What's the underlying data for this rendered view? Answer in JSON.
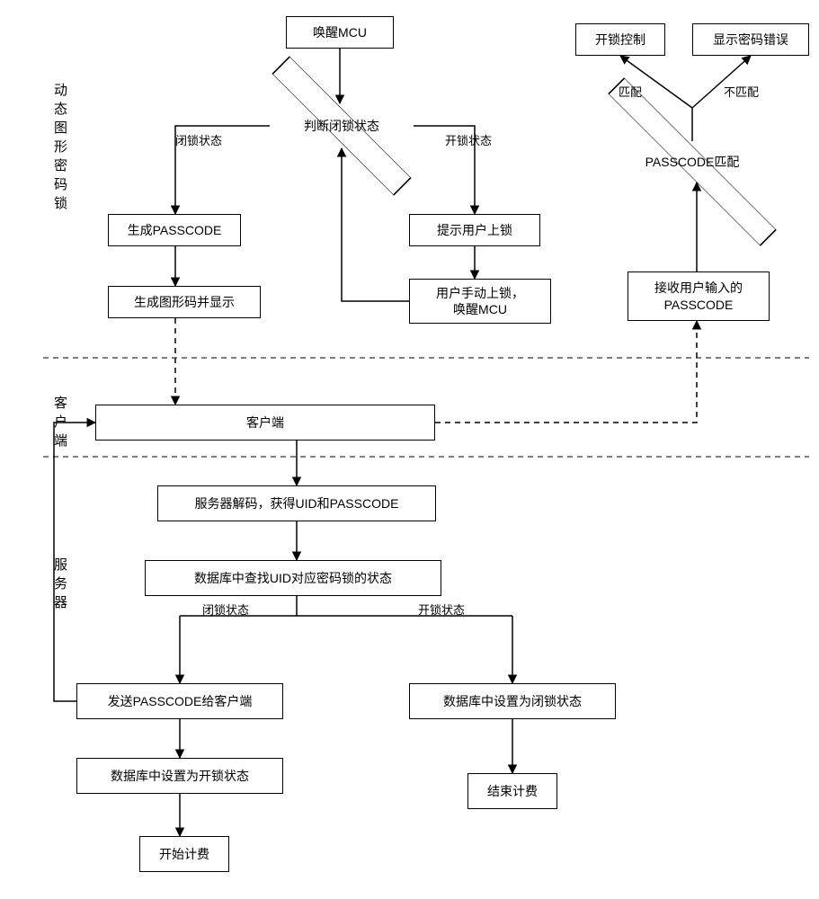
{
  "swimlanes": {
    "lane1": "动态图形密码锁",
    "lane2": "客户端",
    "lane3": "服务器"
  },
  "nodes": {
    "wake_mcu": "唤醒MCU",
    "judge_lock": "判断闭锁状态",
    "gen_passcode": "生成PASSCODE",
    "gen_qr": "生成图形码并显示",
    "prompt_lock": "提示用户上锁",
    "manual_lock": "用户手动上锁，\n唤醒MCU",
    "client": "客户端",
    "server_decode": "服务器解码，获得UID和PASSCODE",
    "db_lookup": "数据库中查找UID对应密码锁的状态",
    "send_passcode": "发送PASSCODE给客户端",
    "set_unlock": "数据库中设置为开锁状态",
    "start_billing": "开始计费",
    "set_lock": "数据库中设置为闭锁状态",
    "end_billing": "结束计费",
    "recv_passcode": "接收用户输入的\nPASSCODE",
    "passcode_match": "PASSCODE匹配",
    "unlock_ctrl": "开锁控制",
    "show_error": "显示密码错误"
  },
  "edge_labels": {
    "locked": "闭锁状态",
    "unlocked": "开锁状态",
    "locked2": "闭锁状态",
    "unlocked2": "开锁状态",
    "match": "匹配",
    "nomatch": "不匹配"
  },
  "chart_data": {
    "type": "flowchart",
    "swimlanes": [
      "动态图形密码锁",
      "客户端",
      "服务器"
    ],
    "nodes": [
      {
        "id": "wake_mcu",
        "label": "唤醒MCU",
        "lane": "动态图形密码锁",
        "shape": "rect"
      },
      {
        "id": "judge_lock",
        "label": "判断闭锁状态",
        "lane": "动态图形密码锁",
        "shape": "diamond"
      },
      {
        "id": "gen_passcode",
        "label": "生成PASSCODE",
        "lane": "动态图形密码锁",
        "shape": "rect"
      },
      {
        "id": "gen_qr",
        "label": "生成图形码并显示",
        "lane": "动态图形密码锁",
        "shape": "rect"
      },
      {
        "id": "prompt_lock",
        "label": "提示用户上锁",
        "lane": "动态图形密码锁",
        "shape": "rect"
      },
      {
        "id": "manual_lock",
        "label": "用户手动上锁，唤醒MCU",
        "lane": "动态图形密码锁",
        "shape": "rect"
      },
      {
        "id": "recv_passcode",
        "label": "接收用户输入的PASSCODE",
        "lane": "动态图形密码锁",
        "shape": "rect"
      },
      {
        "id": "passcode_match",
        "label": "PASSCODE匹配",
        "lane": "动态图形密码锁",
        "shape": "diamond"
      },
      {
        "id": "unlock_ctrl",
        "label": "开锁控制",
        "lane": "动态图形密码锁",
        "shape": "rect"
      },
      {
        "id": "show_error",
        "label": "显示密码错误",
        "lane": "动态图形密码锁",
        "shape": "rect"
      },
      {
        "id": "client",
        "label": "客户端",
        "lane": "客户端",
        "shape": "rect"
      },
      {
        "id": "server_decode",
        "label": "服务器解码，获得UID和PASSCODE",
        "lane": "服务器",
        "shape": "rect"
      },
      {
        "id": "db_lookup",
        "label": "数据库中查找UID对应密码锁的状态",
        "lane": "服务器",
        "shape": "rect"
      },
      {
        "id": "send_passcode",
        "label": "发送PASSCODE给客户端",
        "lane": "服务器",
        "shape": "rect"
      },
      {
        "id": "set_unlock",
        "label": "数据库中设置为开锁状态",
        "lane": "服务器",
        "shape": "rect"
      },
      {
        "id": "start_billing",
        "label": "开始计费",
        "lane": "服务器",
        "shape": "rect"
      },
      {
        "id": "set_lock",
        "label": "数据库中设置为闭锁状态",
        "lane": "服务器",
        "shape": "rect"
      },
      {
        "id": "end_billing",
        "label": "结束计费",
        "lane": "服务器",
        "shape": "rect"
      }
    ],
    "edges": [
      {
        "from": "wake_mcu",
        "to": "judge_lock",
        "style": "solid"
      },
      {
        "from": "judge_lock",
        "to": "gen_passcode",
        "label": "闭锁状态",
        "style": "solid"
      },
      {
        "from": "judge_lock",
        "to": "prompt_lock",
        "label": "开锁状态",
        "style": "solid"
      },
      {
        "from": "gen_passcode",
        "to": "gen_qr",
        "style": "solid"
      },
      {
        "from": "prompt_lock",
        "to": "manual_lock",
        "style": "solid"
      },
      {
        "from": "manual_lock",
        "to": "judge_lock",
        "style": "solid"
      },
      {
        "from": "gen_qr",
        "to": "client",
        "style": "dashed"
      },
      {
        "from": "client",
        "to": "server_decode",
        "style": "solid"
      },
      {
        "from": "server_decode",
        "to": "db_lookup",
        "style": "solid"
      },
      {
        "from": "db_lookup",
        "to": "send_passcode",
        "label": "闭锁状态",
        "style": "solid"
      },
      {
        "from": "db_lookup",
        "to": "set_lock",
        "label": "开锁状态",
        "style": "solid"
      },
      {
        "from": "send_passcode",
        "to": "set_unlock",
        "style": "solid"
      },
      {
        "from": "set_unlock",
        "to": "start_billing",
        "style": "solid"
      },
      {
        "from": "set_lock",
        "to": "end_billing",
        "style": "solid"
      },
      {
        "from": "send_passcode",
        "to": "client",
        "style": "solid"
      },
      {
        "from": "client",
        "to": "recv_passcode",
        "style": "dashed"
      },
      {
        "from": "recv_passcode",
        "to": "passcode_match",
        "style": "solid"
      },
      {
        "from": "passcode_match",
        "to": "unlock_ctrl",
        "label": "匹配",
        "style": "solid"
      },
      {
        "from": "passcode_match",
        "to": "show_error",
        "label": "不匹配",
        "style": "solid"
      }
    ]
  }
}
